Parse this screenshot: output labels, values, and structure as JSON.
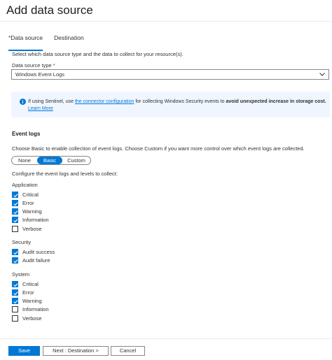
{
  "header": {
    "title": "Add data source"
  },
  "tabs": [
    {
      "label": "Data source",
      "required": "*",
      "active": true
    },
    {
      "label": "Destination",
      "active": false
    }
  ],
  "description": "Select which data source type and the data to collect for your resource(s).",
  "type_field": {
    "label": "Data source type",
    "required": "*",
    "value": "Windows Event Logs"
  },
  "info": {
    "pre": "If using Sentinel, use ",
    "link": "the connector configuration",
    "mid": " for collecting Windows Security events to ",
    "bold": "avoid unexpected increase in storage cost.",
    "learn_more": "Learn More"
  },
  "event_logs": {
    "heading": "Event logs",
    "choose_text": "Choose Basic to enable collection of event logs. Choose Custom if you want more control over which event logs are collected.",
    "modes": [
      "None",
      "Basic",
      "Custom"
    ],
    "selected_mode": "Basic",
    "configure_text": "Configure the event logs and levels to collect:"
  },
  "groups": {
    "application": {
      "title": "Application",
      "items": [
        {
          "label": "Critical",
          "checked": true
        },
        {
          "label": "Error",
          "checked": true
        },
        {
          "label": "Warning",
          "checked": true
        },
        {
          "label": "Information",
          "checked": true
        },
        {
          "label": "Verbose",
          "checked": false
        }
      ]
    },
    "security": {
      "title": "Security",
      "items": [
        {
          "label": "Audit success",
          "checked": true
        },
        {
          "label": "Audit failure",
          "checked": true
        }
      ]
    },
    "system": {
      "title": "System",
      "items": [
        {
          "label": "Critical",
          "checked": true
        },
        {
          "label": "Error",
          "checked": true
        },
        {
          "label": "Warning",
          "checked": true
        },
        {
          "label": "Information",
          "checked": false
        },
        {
          "label": "Verbose",
          "checked": false
        }
      ]
    }
  },
  "footer": {
    "save": "Save",
    "next": "Next : Destination >",
    "cancel": "Cancel"
  },
  "colors": {
    "accent": "#0078d4",
    "info_bg": "#f0f6ff",
    "required": "#a4262c"
  },
  "icons": {
    "info": "info-circle-icon",
    "dropdown": "chevron-down-icon",
    "check": "checkmark-icon"
  }
}
